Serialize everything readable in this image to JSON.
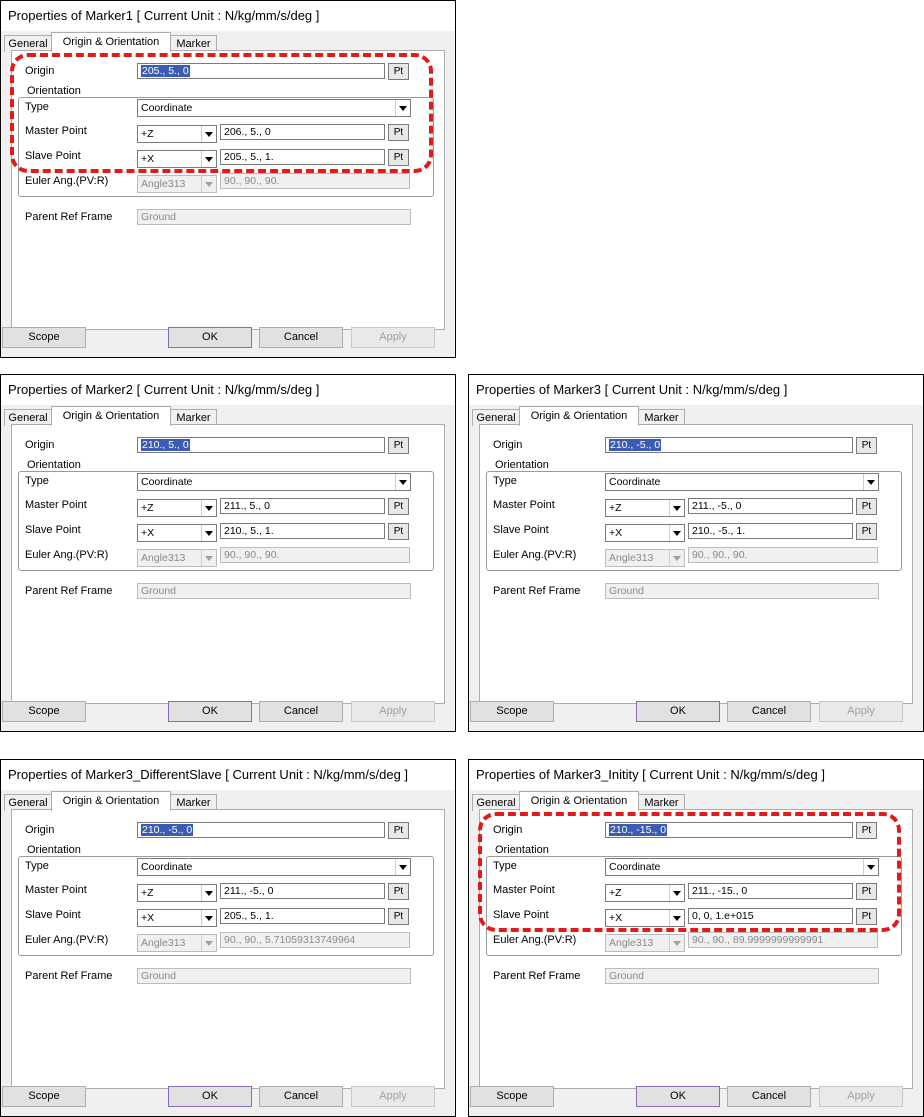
{
  "tabs": {
    "general": "General",
    "origin": "Origin & Orientation",
    "marker": "Marker"
  },
  "labels": {
    "origin": "Origin",
    "orientation": "Orientation",
    "type": "Type",
    "master": "Master Point",
    "slave": "Slave Point",
    "euler": "Euler Ang.(PV:R)",
    "parent": "Parent Ref Frame",
    "pt": "Pt"
  },
  "buttons": {
    "scope": "Scope",
    "ok": "OK",
    "cancel": "Cancel",
    "apply": "Apply"
  },
  "dialogs": [
    {
      "title": "Properties of Marker1 [ Current Unit : N/kg/mm/s/deg ]",
      "origin": "205., 5., 0",
      "type": "Coordinate",
      "master_axis": "+Z",
      "master_point": "206., 5., 0",
      "slave_axis": "+X",
      "slave_point": "205., 5., 1.",
      "euler_seq": "Angle313",
      "euler_value": "90., 90., 90.",
      "parent": "Ground",
      "highlighted": true
    },
    {
      "title": "Properties of Marker2 [ Current Unit : N/kg/mm/s/deg ]",
      "origin": "210., 5., 0",
      "type": "Coordinate",
      "master_axis": "+Z",
      "master_point": "211., 5., 0",
      "slave_axis": "+X",
      "slave_point": "210., 5., 1.",
      "euler_seq": "Angle313",
      "euler_value": "90., 90., 90.",
      "parent": "Ground",
      "highlighted": false
    },
    {
      "title": "Properties of Marker3 [ Current Unit : N/kg/mm/s/deg ]",
      "origin": "210., -5., 0",
      "type": "Coordinate",
      "master_axis": "+Z",
      "master_point": "211., -5., 0",
      "slave_axis": "+X",
      "slave_point": "210., -5., 1.",
      "euler_seq": "Angle313",
      "euler_value": "90., 90., 90.",
      "parent": "Ground",
      "highlighted": false
    },
    {
      "title": "Properties of Marker3_DifferentSlave [ Current Unit : N/kg/mm/s/deg ]",
      "origin": "210., -5., 0",
      "type": "Coordinate",
      "master_axis": "+Z",
      "master_point": "211., -5., 0",
      "slave_axis": "+X",
      "slave_point": "205., 5., 1.",
      "euler_seq": "Angle313",
      "euler_value": "90., 90., 5.71059313749964",
      "parent": "Ground",
      "highlighted": false
    },
    {
      "title": "Properties of Marker3_Initity [ Current Unit : N/kg/mm/s/deg ]",
      "origin": "210., -15., 0",
      "type": "Coordinate",
      "master_axis": "+Z",
      "master_point": "211., -15., 0",
      "slave_axis": "+X",
      "slave_point": "0, 0, 1.e+015",
      "euler_seq": "Angle313",
      "euler_value": "90., 90., 89.9999999999991",
      "parent": "Ground",
      "highlighted": true
    }
  ]
}
